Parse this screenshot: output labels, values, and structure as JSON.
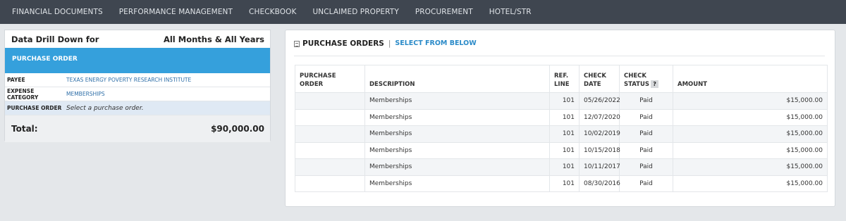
{
  "nav": {
    "items": [
      "FINANCIAL DOCUMENTS",
      "PERFORMANCE MANAGEMENT",
      "CHECKBOOK",
      "UNCLAIMED PROPERTY",
      "PROCUREMENT",
      "HOTEL/STR"
    ]
  },
  "drill": {
    "heading": "Data Drill Down for",
    "period": "All Months & All Years",
    "banner": "PURCHASE ORDER",
    "payee_key": "PAYEE",
    "payee_value": "TEXAS ENERGY POVERTY RESEARCH INSTITUTE",
    "category_key": "EXPENSE CATEGORY",
    "category_value": "MEMBERSHIPS",
    "po_key": "PURCHASE ORDER",
    "po_value": "Select a purchase order.",
    "total_label": "Total:",
    "total_value": "$90,000.00"
  },
  "orders": {
    "title": "PURCHASE ORDERS",
    "separator": "|",
    "link": "SELECT FROM BELOW",
    "columns": {
      "po": "PURCHASE ORDER",
      "desc": "DESCRIPTION",
      "ref1": "REF.",
      "ref2": "LINE",
      "date1": "CHECK",
      "date2": "DATE",
      "status1": "CHECK",
      "status2": "STATUS",
      "help": "?",
      "amount": "AMOUNT"
    },
    "rows": [
      {
        "po": "",
        "desc": "Memberships",
        "ref": "101",
        "date": "05/26/2022",
        "status": "Paid",
        "amount": "$15,000.00"
      },
      {
        "po": "",
        "desc": "Memberships",
        "ref": "101",
        "date": "12/07/2020",
        "status": "Paid",
        "amount": "$15,000.00"
      },
      {
        "po": "",
        "desc": "Memberships",
        "ref": "101",
        "date": "10/02/2019",
        "status": "Paid",
        "amount": "$15,000.00"
      },
      {
        "po": "",
        "desc": "Memberships",
        "ref": "101",
        "date": "10/15/2018",
        "status": "Paid",
        "amount": "$15,000.00"
      },
      {
        "po": "",
        "desc": "Memberships",
        "ref": "101",
        "date": "10/11/2017",
        "status": "Paid",
        "amount": "$15,000.00"
      },
      {
        "po": "",
        "desc": "Memberships",
        "ref": "101",
        "date": "08/30/2016",
        "status": "Paid",
        "amount": "$15,000.00"
      }
    ]
  },
  "icons": {
    "document": "document-icon",
    "help": "help-icon"
  },
  "colors": {
    "nav_bg": "#3f4650",
    "banner": "#35a0dc",
    "link": "#2a8ac8"
  }
}
